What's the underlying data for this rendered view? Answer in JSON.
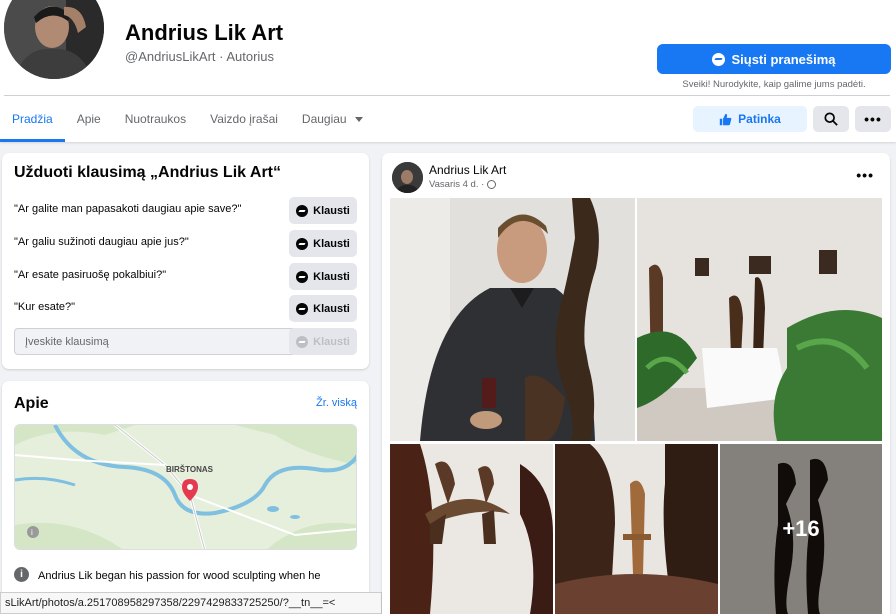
{
  "page": {
    "name": "Andrius Lik Art",
    "handle": "@AndriusLikArt · Autorius",
    "message_button": "Siųsti pranešimą",
    "greeting": "Sveiki! Nurodykite, kaip galime jums padėti."
  },
  "tabs": [
    {
      "label": "Pradžia",
      "active": true
    },
    {
      "label": "Apie"
    },
    {
      "label": "Nuotraukos"
    },
    {
      "label": "Vaizdo įrašai"
    },
    {
      "label": "Daugiau"
    }
  ],
  "actions": {
    "like_label": "Patinka",
    "search_icon": "search-icon",
    "more_icon": "more-icon"
  },
  "ask": {
    "title": "Užduoti klausimą „Andrius Lik Art“",
    "questions": [
      {
        "text": "\"Ar galite man papasakoti daugiau apie save?\"",
        "button": "Klausti"
      },
      {
        "text": "\"Ar galiu sužinoti daugiau apie jus?\"",
        "button": "Klausti"
      },
      {
        "text": "\"Ar esate pasiruošę pokalbiui?\"",
        "button": "Klausti"
      },
      {
        "text": "\"Kur esate?\"",
        "button": "Klausti"
      }
    ],
    "input_placeholder": "Įveskite klausimą",
    "input_button": "Klausti"
  },
  "about": {
    "title": "Apie",
    "see_all": "Žr. viską",
    "map_label": "BIRŠTONAS",
    "info_icon": "i",
    "text": "Andrius Lik began his passion for wood sculpting when he"
  },
  "status_url": "sLikArt/photos/a.251708958297358/2297429833725250/?__tn__=<",
  "post": {
    "author": "Andrius Lik Art",
    "date": "Vasaris 4 d. ·",
    "more_photos": "+16"
  },
  "colors": {
    "accent": "#1877f2",
    "background": "#f0f2f5",
    "text_secondary": "#65676b"
  }
}
